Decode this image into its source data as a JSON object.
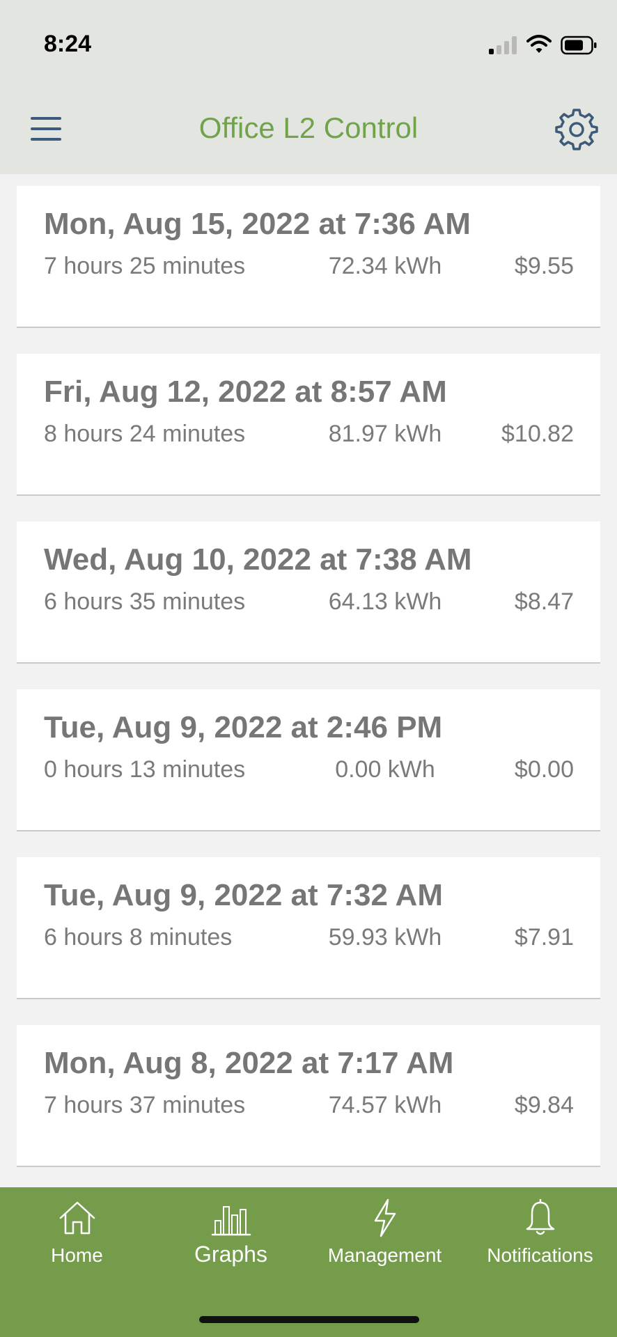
{
  "status_bar": {
    "time": "8:24"
  },
  "header": {
    "title": "Office L2 Control",
    "menu_icon": "hamburger-menu-icon",
    "settings_icon": "gear-icon"
  },
  "sessions": [
    {
      "date": "Mon, Aug 15, 2022 at 7:36 AM",
      "duration": "7 hours 25 minutes",
      "energy": "72.34 kWh",
      "cost": "$9.55"
    },
    {
      "date": "Fri, Aug 12, 2022 at 8:57 AM",
      "duration": "8 hours 24 minutes",
      "energy": "81.97 kWh",
      "cost": "$10.82"
    },
    {
      "date": "Wed, Aug 10, 2022 at 7:38 AM",
      "duration": "6 hours 35 minutes",
      "energy": "64.13 kWh",
      "cost": "$8.47"
    },
    {
      "date": "Tue, Aug 9, 2022 at 2:46 PM",
      "duration": "0 hours 13 minutes",
      "energy": "0.00 kWh",
      "cost": "$0.00"
    },
    {
      "date": "Tue, Aug 9, 2022 at 7:32 AM",
      "duration": "6 hours 8 minutes",
      "energy": "59.93 kWh",
      "cost": "$7.91"
    },
    {
      "date": "Mon, Aug 8, 2022 at 7:17 AM",
      "duration": "7 hours 37 minutes",
      "energy": "74.57 kWh",
      "cost": "$9.84"
    }
  ],
  "tabs": [
    {
      "label": "Home",
      "icon": "home-icon"
    },
    {
      "label": "Graphs",
      "icon": "bar-chart-icon",
      "selected": true
    },
    {
      "label": "Management",
      "icon": "lightning-bolt-icon"
    },
    {
      "label": "Notifications",
      "icon": "bell-icon"
    }
  ],
  "colors": {
    "accent_green": "#71a34b",
    "tabbar_green": "#759c4b",
    "header_bg": "#e3e5e1",
    "menu_icon": "#3d5a78"
  }
}
